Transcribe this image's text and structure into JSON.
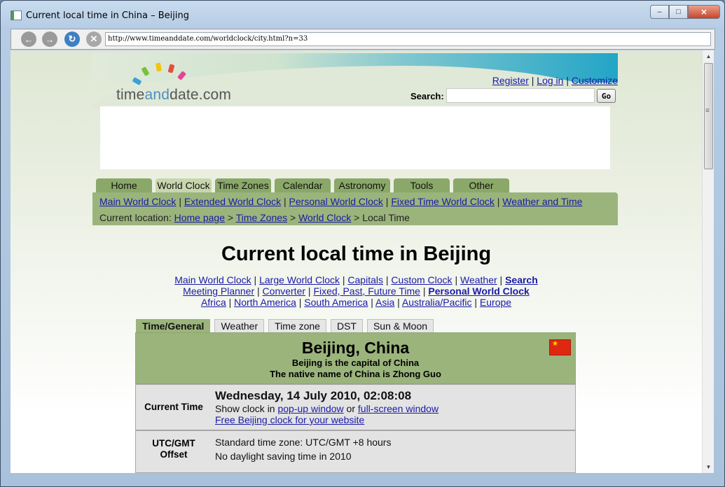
{
  "window": {
    "title": "Current local time in China – Beijing",
    "controls": {
      "minimize": "–",
      "maximize": "□",
      "close": "✕"
    }
  },
  "toolbar": {
    "url": "http://www.timeanddate.com/worldclock/city.html?n=33",
    "icons": [
      "back-icon",
      "forward-icon",
      "reload-icon",
      "stop-icon"
    ]
  },
  "header": {
    "logo": {
      "part1": "time",
      "part2": "and",
      "part3": "date.com"
    },
    "links": {
      "register": "Register",
      "login": "Log in",
      "customize": "Customize",
      "sep": "|"
    },
    "search_label": "Search:",
    "search_placeholder": "",
    "go_label": "Go"
  },
  "nav": {
    "tabs": [
      "Home",
      "World Clock",
      "Time Zones",
      "Calendar",
      "Astronomy",
      "Tools",
      "Other"
    ],
    "active_tab": "World Clock",
    "sub_links": [
      "Main World Clock",
      "Extended World Clock",
      "Personal World Clock",
      "Fixed Time World Clock",
      "Weather and Time"
    ],
    "location_label": "Current location:",
    "breadcrumb": [
      "Home page",
      "Time Zones",
      "World Clock"
    ],
    "breadcrumb_current": "Local Time"
  },
  "main": {
    "title": "Current local time in Beijing",
    "link_rows": [
      [
        "Main World Clock",
        "Large World Clock",
        "Capitals",
        "Custom Clock",
        "Weather",
        "Search"
      ],
      [
        "Meeting Planner",
        "Converter",
        "Fixed, Past, Future Time",
        "Personal World Clock"
      ],
      [
        "Africa",
        "North America",
        "South America",
        "Asia",
        "Australia/Pacific",
        "Europe"
      ]
    ],
    "content_tabs": [
      "Time/General",
      "Weather",
      "Time zone",
      "DST",
      "Sun & Moon"
    ],
    "city": {
      "name": "Beijing, China",
      "capital_note": "Beijing is the capital of China",
      "native_note": "The native name of China is Zhong Guo"
    },
    "current_time": {
      "label": "Current Time",
      "value": "Wednesday, 14 July 2010, 02:08:08",
      "show_prefix": "Show clock in",
      "popup_link": "pop-up window",
      "or": "or",
      "fullscreen_link": "full-screen window",
      "free_clock_link": "Free Beijing clock for your website"
    },
    "offset": {
      "label_line1": "UTC/GMT",
      "label_line2": "Offset",
      "line1": "Standard time zone: UTC/GMT +8 hours",
      "line2": "No daylight saving time in 2010"
    }
  },
  "colors": {
    "nav_green": "#8aa868",
    "panel_green": "#9bb47c",
    "link_blue": "#1a1aa6"
  }
}
